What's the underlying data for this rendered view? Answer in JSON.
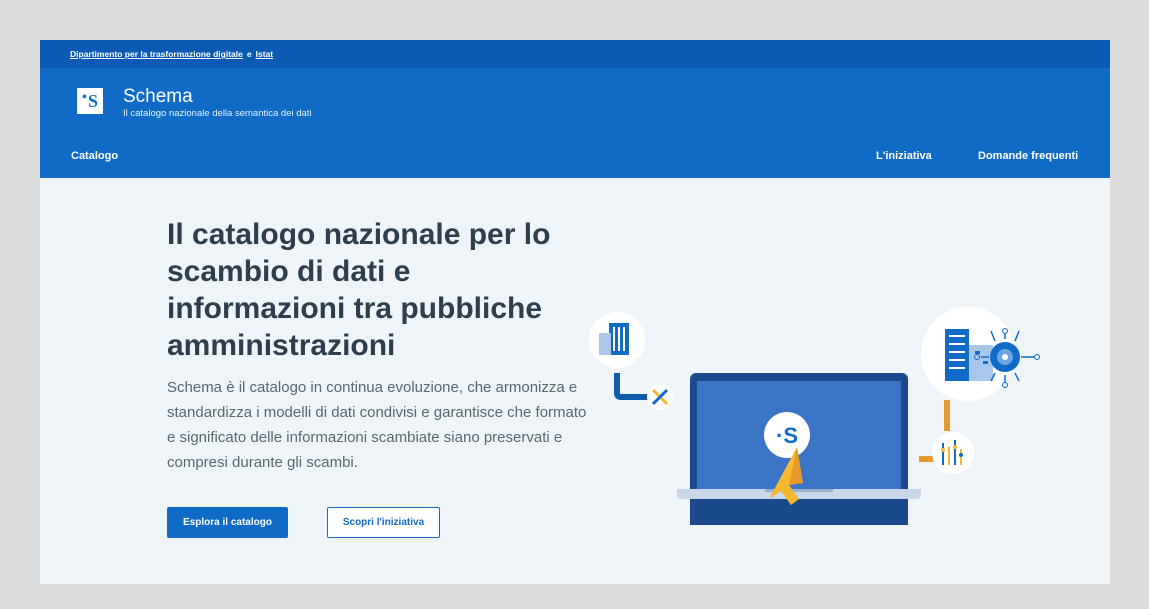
{
  "slim_header": {
    "link1": "Dipartimento per la trasformazione digitale",
    "separator": "e",
    "link2": "Istat"
  },
  "brand": {
    "logo_letter": "S",
    "title": "Schema",
    "subtitle": "Il catalogo nazionale della semantica dei dati"
  },
  "nav": {
    "left": "Catalogo",
    "right": [
      "L'iniziativa",
      "Domande frequenti"
    ]
  },
  "hero": {
    "title": "Il catalogo nazionale per lo scambio di dati e informazioni tra pubbliche amministrazioni",
    "description": "Schema è il catalogo in continua evoluzione, che armonizza e standardizza i modelli di dati condivisi e garantisce che formato e significato delle informazioni scambiate siano preservati e compresi durante gli scambi.",
    "primary_button": "Esplora il catalogo",
    "secondary_button": "Scopri l'iniziativa"
  },
  "colors": {
    "brand_blue": "#0f6bc6",
    "slim_blue": "#0b5bb5",
    "hero_bg": "#eef4f8",
    "title_text": "#2f3e4d",
    "accent_orange": "#e69a2e",
    "accent_yellow": "#f7b72e"
  },
  "icons": {
    "building": "building-icon",
    "exchange": "x-mark-icon",
    "laptop": "laptop-icon",
    "cursor": "cursor-arrow-icon",
    "gear": "gear-circuit-icon",
    "graph": "analytics-icon"
  }
}
